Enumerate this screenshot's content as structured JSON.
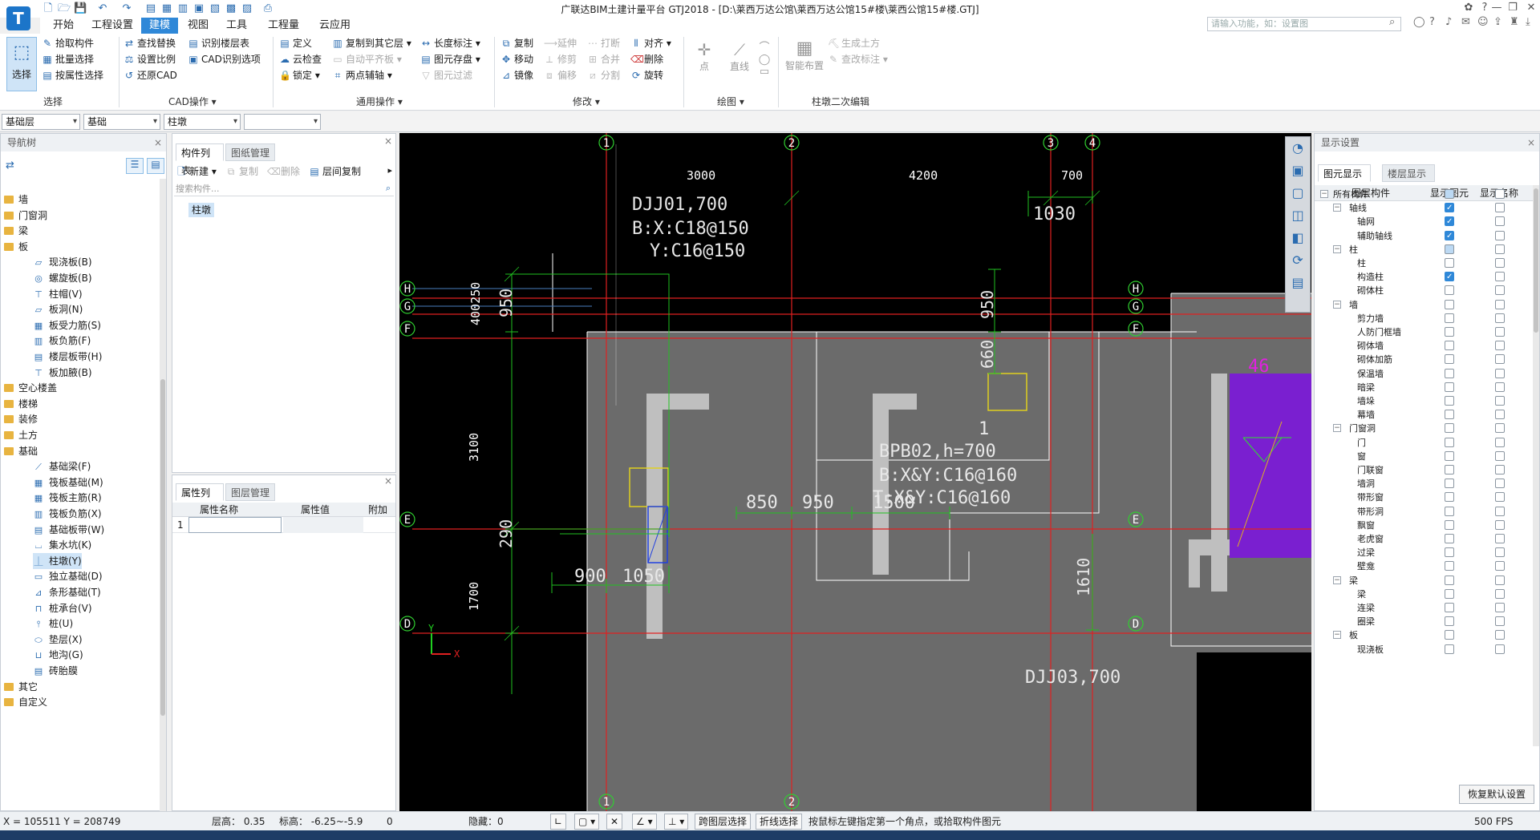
{
  "window": {
    "title": "广联达BIM土建计量平台 GTJ2018 - [D:\\莱西万达公馆\\莱西万达公馆15#楼\\莱西公馆15#楼.GTJ]",
    "logo": "T",
    "min": "—",
    "restore": "❐",
    "close": "✕"
  },
  "menu": [
    "开始",
    "工程设置",
    "建模",
    "视图",
    "工具",
    "工程量",
    "云应用"
  ],
  "menu_active": "建模",
  "search_placeholder": "请输入功能，如：设置图",
  "ribbon": {
    "select": {
      "big": "选择",
      "items": [
        "拾取构件",
        "批量选择",
        "按属性选择"
      ],
      "group": "选择"
    },
    "cad": {
      "items": [
        "查找替换",
        "识别楼层表",
        "设置比例",
        "CAD识别选项",
        "还原CAD"
      ],
      "group": "CAD操作"
    },
    "common": {
      "items": [
        "定义",
        "复制到其它层",
        "长度标注",
        "云检查",
        "自动平齐板",
        "图元存盘",
        "锁定",
        "两点辅轴",
        "图元过滤"
      ],
      "group": "通用操作"
    },
    "modify": {
      "items": [
        "复制",
        "延伸",
        "打断",
        "对齐",
        "移动",
        "修剪",
        "合并",
        "删除",
        "镜像",
        "偏移",
        "分割",
        "旋转"
      ],
      "group": "修改"
    },
    "draw": {
      "items": [
        "点",
        "直线"
      ],
      "group": "绘图"
    },
    "smart": {
      "items": [
        "智能布置",
        "生成土方",
        "查改标注"
      ],
      "group": "柱墩二次编辑"
    }
  },
  "selectors": [
    "基础层",
    "基础",
    "柱墩",
    ""
  ],
  "nav": {
    "title": "导航树",
    "items": [
      {
        "type": "folder",
        "label": "墙"
      },
      {
        "type": "folder",
        "label": "门窗洞"
      },
      {
        "type": "folder",
        "label": "梁"
      },
      {
        "type": "folder",
        "label": "板"
      },
      {
        "type": "child",
        "label": "现浇板(B)"
      },
      {
        "type": "child",
        "label": "螺旋板(B)"
      },
      {
        "type": "child",
        "label": "柱帽(V)"
      },
      {
        "type": "child",
        "label": "板洞(N)"
      },
      {
        "type": "child",
        "label": "板受力筋(S)"
      },
      {
        "type": "child",
        "label": "板负筋(F)"
      },
      {
        "type": "child",
        "label": "楼层板带(H)"
      },
      {
        "type": "child",
        "label": "板加腋(B)"
      },
      {
        "type": "folder",
        "label": "空心楼盖"
      },
      {
        "type": "folder",
        "label": "楼梯"
      },
      {
        "type": "folder",
        "label": "装修"
      },
      {
        "type": "folder",
        "label": "土方"
      },
      {
        "type": "folder",
        "label": "基础"
      },
      {
        "type": "child",
        "label": "基础梁(F)"
      },
      {
        "type": "child",
        "label": "筏板基础(M)"
      },
      {
        "type": "child",
        "label": "筏板主筋(R)"
      },
      {
        "type": "child",
        "label": "筏板负筋(X)"
      },
      {
        "type": "child",
        "label": "基础板带(W)"
      },
      {
        "type": "child",
        "label": "集水坑(K)"
      },
      {
        "type": "child",
        "label": "柱墩(Y)"
      },
      {
        "type": "child",
        "label": "独立基础(D)"
      },
      {
        "type": "child",
        "label": "条形基础(T)"
      },
      {
        "type": "child",
        "label": "桩承台(V)"
      },
      {
        "type": "child",
        "label": "桩(U)"
      },
      {
        "type": "child",
        "label": "垫层(X)"
      },
      {
        "type": "child",
        "label": "地沟(G)"
      },
      {
        "type": "child",
        "label": "砖胎膜"
      },
      {
        "type": "folder",
        "label": "其它"
      },
      {
        "type": "folder",
        "label": "自定义"
      }
    ]
  },
  "comp_list": {
    "tabs": [
      "构件列表",
      "图纸管理"
    ],
    "toolbar": [
      "新建",
      "复制",
      "删除",
      "层间复制"
    ],
    "search_placeholder": "搜索构件...",
    "items": [
      "柱墩"
    ]
  },
  "props": {
    "tabs": [
      "属性列表",
      "图层管理"
    ],
    "headers": [
      "属性名称",
      "属性值",
      "附加"
    ],
    "row1": "1"
  },
  "display": {
    "title": "显示设置",
    "tabs": [
      "图元显示",
      "楼层显示"
    ],
    "headers": [
      "图层构件",
      "显示图元",
      "显示名称"
    ],
    "rows": [
      {
        "label": "所有构件",
        "level": 0,
        "exp": "−",
        "show": "part"
      },
      {
        "label": "轴线",
        "level": 1,
        "exp": "−",
        "show": "on"
      },
      {
        "label": "轴网",
        "level": 2,
        "show": "on"
      },
      {
        "label": "辅助轴线",
        "level": 2,
        "show": "on"
      },
      {
        "label": "柱",
        "level": 1,
        "exp": "−",
        "show": "part"
      },
      {
        "label": "柱",
        "level": 2,
        "show": "off"
      },
      {
        "label": "构造柱",
        "level": 2,
        "show": "on"
      },
      {
        "label": "砌体柱",
        "level": 2,
        "show": "off"
      },
      {
        "label": "墙",
        "level": 1,
        "exp": "−",
        "show": "off"
      },
      {
        "label": "剪力墙",
        "level": 2,
        "show": "off"
      },
      {
        "label": "人防门框墙",
        "level": 2,
        "show": "off"
      },
      {
        "label": "砌体墙",
        "level": 2,
        "show": "off"
      },
      {
        "label": "砌体加筋",
        "level": 2,
        "show": "off"
      },
      {
        "label": "保温墙",
        "level": 2,
        "show": "off"
      },
      {
        "label": "暗梁",
        "level": 2,
        "show": "off"
      },
      {
        "label": "墙垛",
        "level": 2,
        "show": "off"
      },
      {
        "label": "幕墙",
        "level": 2,
        "show": "off"
      },
      {
        "label": "门窗洞",
        "level": 1,
        "exp": "−",
        "show": "off"
      },
      {
        "label": "门",
        "level": 2,
        "show": "off"
      },
      {
        "label": "窗",
        "level": 2,
        "show": "off"
      },
      {
        "label": "门联窗",
        "level": 2,
        "show": "off"
      },
      {
        "label": "墙洞",
        "level": 2,
        "show": "off"
      },
      {
        "label": "带形窗",
        "level": 2,
        "show": "off"
      },
      {
        "label": "带形洞",
        "level": 2,
        "show": "off"
      },
      {
        "label": "飘窗",
        "level": 2,
        "show": "off"
      },
      {
        "label": "老虎窗",
        "level": 2,
        "show": "off"
      },
      {
        "label": "过梁",
        "level": 2,
        "show": "off"
      },
      {
        "label": "壁龛",
        "level": 2,
        "show": "off"
      },
      {
        "label": "梁",
        "level": 1,
        "exp": "−",
        "show": "off"
      },
      {
        "label": "梁",
        "level": 2,
        "show": "off"
      },
      {
        "label": "连梁",
        "level": 2,
        "show": "off"
      },
      {
        "label": "圈梁",
        "level": 2,
        "show": "off"
      },
      {
        "label": "板",
        "level": 1,
        "exp": "−",
        "show": "off"
      },
      {
        "label": "现浇板",
        "level": 2,
        "show": "off"
      }
    ],
    "restore": "恢复默认设置"
  },
  "cad": {
    "axes_top": [
      "1",
      "2",
      "3",
      "4"
    ],
    "axes_left": [
      "H",
      "G",
      "F",
      "E",
      "D"
    ],
    "dims_top": [
      "3000",
      "4200",
      "700"
    ],
    "texts": {
      "djj01a": "DJJ01,700",
      "djj01b": "B:X:C18@150",
      "djj01c": "Y:C16@150",
      "d1030": "1030",
      "d400250": "400250",
      "d950a": "950",
      "d950b": "950",
      "d660": "660",
      "d1": "1",
      "bpb1": "BPB02,h=700",
      "bpb2": "B:X&Y:C16@160",
      "bpb3": "T:X&Y:C16@160",
      "d850": "850",
      "d950c": "950",
      "d1500": "1500",
      "d3100": "3100",
      "d290": "290",
      "d900": "900",
      "d1050": "1050",
      "d1700": "1700",
      "d1610": "1610",
      "djj03": "DJJ03,700",
      "d46": "46",
      "ucs_y": "Y",
      "ucs_x": "X"
    }
  },
  "status": {
    "coords": "X = 105511 Y = 208749",
    "floor_h": "层高： 0.35",
    "elev": "标高： -6.25~-5.9",
    "zero": "0",
    "hidden": "隐藏：0",
    "cross": "跨图层选择",
    "poly": "折线选择",
    "hint": "按鼠标左键指定第一个角点，或拾取构件图元",
    "fps": "500 FPS"
  },
  "colors": {
    "accent": "#2f88d8",
    "cad_bg": "#000000",
    "slab": "#6b6b6b",
    "axis_red": "#e02020",
    "dim_green": "#20c020",
    "purple": "#7a1fd0"
  }
}
